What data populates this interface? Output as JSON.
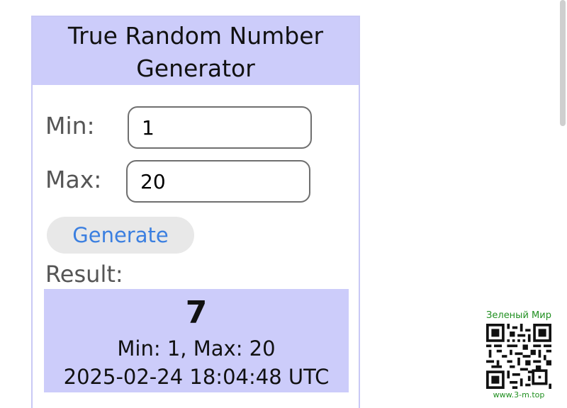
{
  "widget": {
    "title": "True Random Number Generator",
    "min_label": "Min:",
    "min_value": "1",
    "max_label": "Max:",
    "max_value": "20",
    "generate_label": "Generate",
    "result_label": "Result:",
    "result": {
      "value": "7",
      "range_text": "Min: 1, Max: 20",
      "timestamp": "2025-02-24 18:04:48 UTC"
    },
    "header_bg": "#ccccfa",
    "button_text_color": "#3b7fe0"
  },
  "watermark": {
    "title": "Зеленый Мир",
    "url": "www.3-m.top",
    "color": "#1f8f1f",
    "icon": "qr-code-icon"
  }
}
